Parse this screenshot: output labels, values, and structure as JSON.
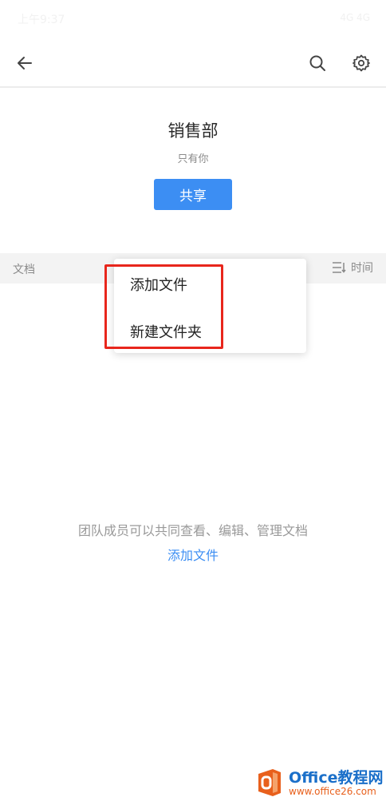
{
  "status_bar": {
    "time": "上午9:37",
    "indicators": "4G 4G"
  },
  "nav": {
    "back_icon": "arrow-left-icon",
    "search_icon": "search-icon",
    "settings_icon": "gear-icon"
  },
  "team": {
    "name": "销售部",
    "members": "只有你",
    "share_label": "共享"
  },
  "list_header": {
    "label": "文档",
    "sort_label": "时间",
    "sort_icon": "sort-icon"
  },
  "menu": {
    "items": [
      {
        "label": "添加文件"
      },
      {
        "label": "新建文件夹"
      }
    ]
  },
  "empty_state": {
    "description": "团队成员可以共同查看、编辑、管理文档",
    "link": "添加文件"
  },
  "watermark": {
    "title": "Office教程网",
    "url": "www.office26.com"
  },
  "colors": {
    "accent": "#3c8ef3",
    "highlight": "#e8261c"
  }
}
